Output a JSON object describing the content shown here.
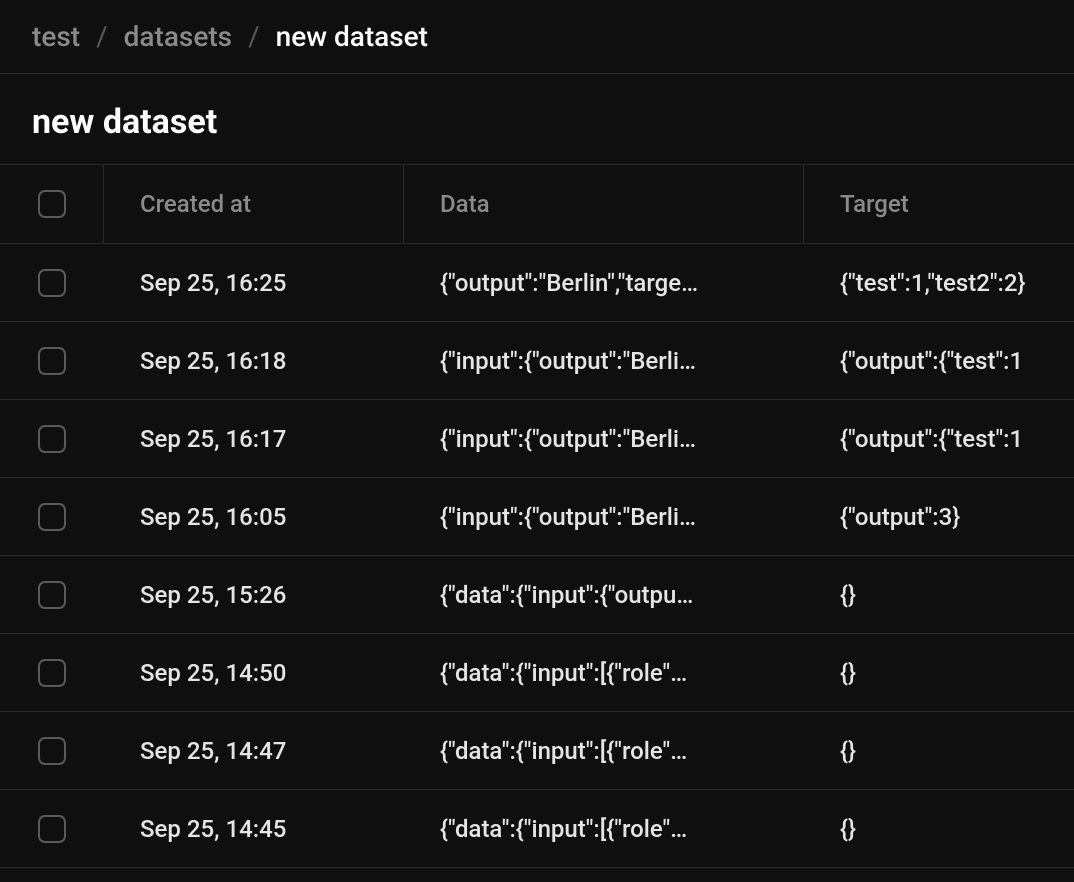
{
  "breadcrumb": {
    "items": [
      {
        "label": "test"
      },
      {
        "label": "datasets"
      },
      {
        "label": "new dataset"
      }
    ]
  },
  "page": {
    "title": "new dataset"
  },
  "table": {
    "columns": {
      "created_at": "Created at",
      "data": "Data",
      "target": "Target"
    },
    "rows": [
      {
        "created_at": "Sep 25, 16:25",
        "data": "{\"output\":\"Berlin\",\"targe…",
        "target": "{\"test\":1,\"test2\":2}"
      },
      {
        "created_at": "Sep 25, 16:18",
        "data": "{\"input\":{\"output\":\"Berli…",
        "target": "{\"output\":{\"test\":1"
      },
      {
        "created_at": "Sep 25, 16:17",
        "data": "{\"input\":{\"output\":\"Berli…",
        "target": "{\"output\":{\"test\":1"
      },
      {
        "created_at": "Sep 25, 16:05",
        "data": "{\"input\":{\"output\":\"Berli…",
        "target": "{\"output\":3}"
      },
      {
        "created_at": "Sep 25, 15:26",
        "data": "{\"data\":{\"input\":{\"outpu…",
        "target": "{}"
      },
      {
        "created_at": "Sep 25, 14:50",
        "data": "{\"data\":{\"input\":[{\"role\"…",
        "target": "{}"
      },
      {
        "created_at": "Sep 25, 14:47",
        "data": "{\"data\":{\"input\":[{\"role\"…",
        "target": "{}"
      },
      {
        "created_at": "Sep 25, 14:45",
        "data": "{\"data\":{\"input\":[{\"role\"…",
        "target": "{}"
      }
    ]
  }
}
